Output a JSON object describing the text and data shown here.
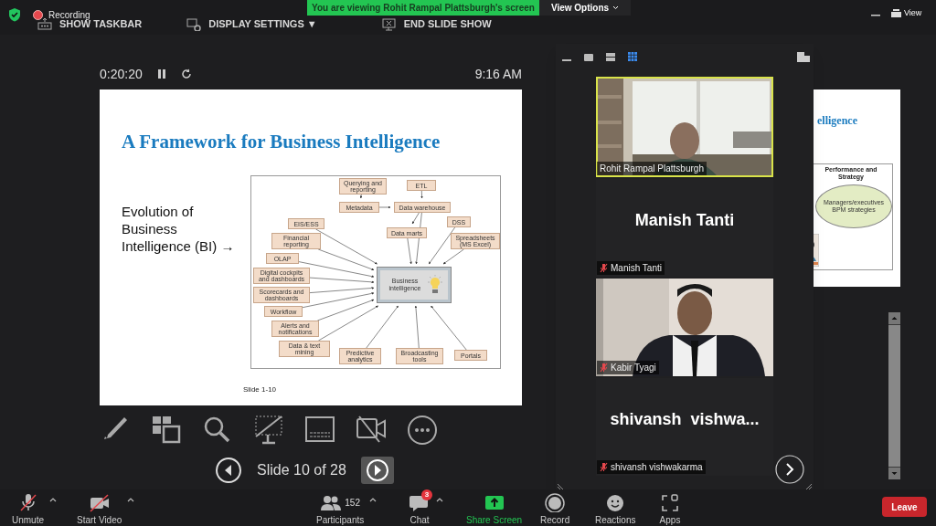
{
  "top_bar": {
    "recording": "Recording",
    "controls": [
      {
        "kind": "taskbar",
        "label": "SHOW TASKBAR"
      },
      {
        "kind": "display",
        "label": "DISPLAY SETTINGS ▼"
      },
      {
        "kind": "end",
        "label": "END SLIDE SHOW"
      }
    ],
    "banner": "You are viewing Rohit Rampal Plattsburgh's screen",
    "view_options": "View Options",
    "view_button": "View"
  },
  "presenter": {
    "timer": "0:20:20",
    "clock": "9:16 AM",
    "slide": {
      "title": "A Framework for Business Intelligence",
      "text": "Evolution of Business Intelligence (BI) →",
      "footer": "Slide 1-10",
      "diagram": [
        {
          "kind": "hub",
          "label": "Business intelligence"
        },
        {
          "kind": "box",
          "label": "Querying and reporting"
        },
        {
          "kind": "box",
          "label": "ETL"
        },
        {
          "kind": "box",
          "label": "Metadata"
        },
        {
          "kind": "box",
          "label": "Data warehouse"
        },
        {
          "kind": "box",
          "label": "EIS/ESS"
        },
        {
          "kind": "box",
          "label": "DSS"
        },
        {
          "kind": "box",
          "label": "Financial reporting"
        },
        {
          "kind": "box",
          "label": "Data marts"
        },
        {
          "kind": "box",
          "label": "Spreadsheets (MS Excel)"
        },
        {
          "kind": "box",
          "label": "OLAP"
        },
        {
          "kind": "box",
          "label": "Digital cockpits and dashboards"
        },
        {
          "kind": "box",
          "label": "Scorecards and dashboards"
        },
        {
          "kind": "box",
          "label": "Workflow"
        },
        {
          "kind": "box",
          "label": "Alerts and notifications"
        },
        {
          "kind": "box",
          "label": "Data & text mining"
        },
        {
          "kind": "box",
          "label": "Predictive analytics"
        },
        {
          "kind": "box",
          "label": "Broadcasting tools"
        },
        {
          "kind": "box",
          "label": "Portals"
        }
      ]
    },
    "slide_tools": [
      {
        "kind": "pen"
      },
      {
        "kind": "slides"
      },
      {
        "kind": "zoom"
      },
      {
        "kind": "black"
      },
      {
        "kind": "subtitles"
      },
      {
        "kind": "camera"
      },
      {
        "kind": "more"
      }
    ],
    "slide_counter": "Slide 10 of 28",
    "next_slide": {
      "title": "elligence",
      "diagram_title": "Performance and Strategy",
      "ellipse": "Managers/executives BPM strategies"
    }
  },
  "gallery": {
    "view_modes": [
      {
        "kind": "minimize",
        "selected": false
      },
      {
        "kind": "speaker",
        "selected": false
      },
      {
        "kind": "strip",
        "selected": false
      },
      {
        "kind": "gallery",
        "selected": true
      }
    ],
    "tiles": [
      {
        "kind": "video",
        "name": "Rohit Rampal Plattsburgh",
        "muted": false,
        "speaking": true
      },
      {
        "kind": "name",
        "display": "Manish Tanti",
        "name": "Manish Tanti",
        "muted": true,
        "speaking": false
      },
      {
        "kind": "video",
        "name": "Kabir Tyagi",
        "muted": true,
        "speaking": false
      },
      {
        "kind": "name",
        "display": "shivansh  vishwa...",
        "name": "shivansh vishwakarma",
        "muted": true,
        "speaking": false
      }
    ]
  },
  "toolbar": [
    {
      "kind": "mic",
      "label": "Unmute",
      "caret": true
    },
    {
      "kind": "video",
      "label": "Start Video",
      "caret": true
    },
    {
      "kind": "participants",
      "label": "Participants",
      "count": "152",
      "caret": true
    },
    {
      "kind": "chat",
      "label": "Chat",
      "badge": "3",
      "caret": true
    },
    {
      "kind": "share",
      "label": "Share Screen",
      "caret": false
    },
    {
      "kind": "record",
      "label": "Record",
      "caret": false
    },
    {
      "kind": "reactions",
      "label": "Reactions",
      "caret": false
    },
    {
      "kind": "apps",
      "label": "Apps",
      "caret": false
    }
  ],
  "leave": "Leave"
}
